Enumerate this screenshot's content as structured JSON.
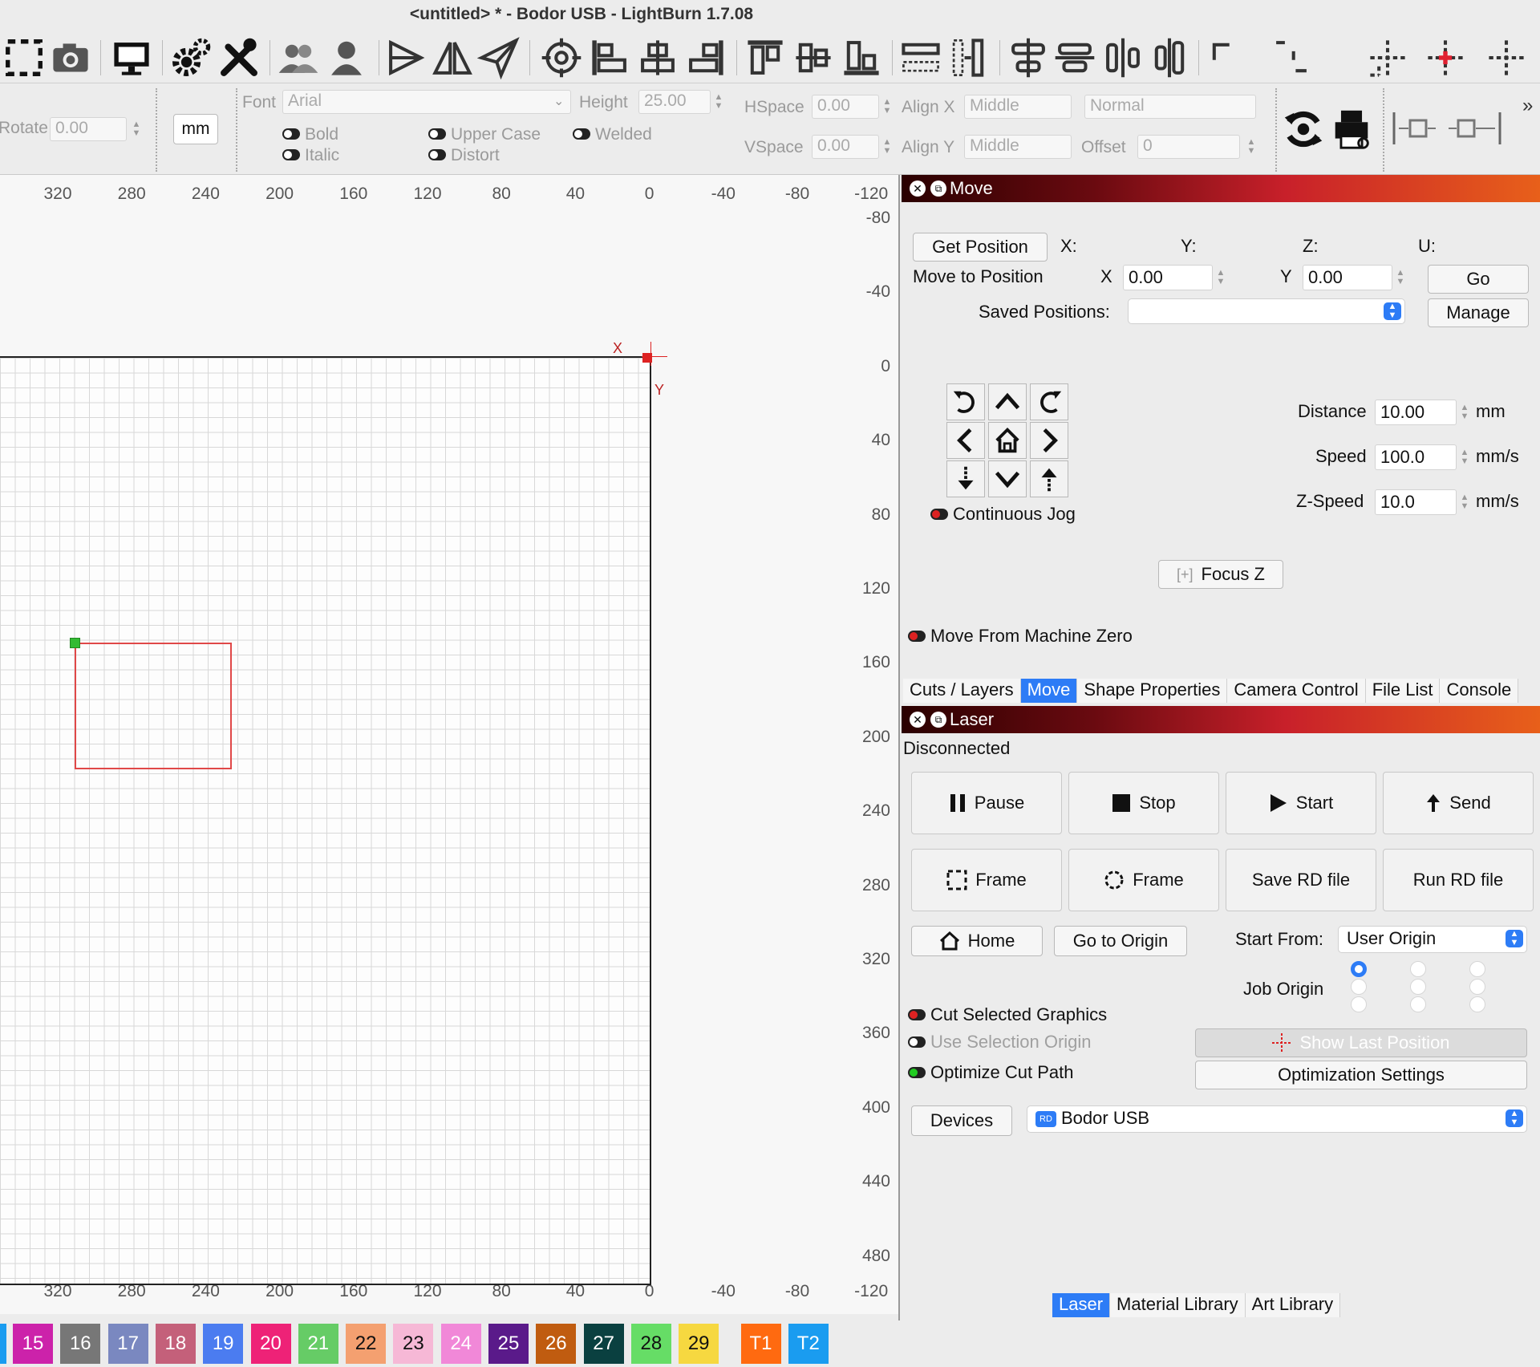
{
  "window": {
    "title": "<untitled> * - Bodor USB - LightBurn 1.7.08"
  },
  "toolbar": {
    "icons": [
      "select-icon",
      "camera-icon",
      "monitor-icon",
      "settings-icon",
      "tools-icon",
      "users-icon",
      "user-icon",
      "flip-horizontal-icon",
      "mirror-icon",
      "send-icon",
      "target-icon",
      "align-left-icon",
      "align-center-icon",
      "align-right-icon",
      "align-top-icon",
      "align-middle-icon",
      "align-bottom-icon",
      "distribute-h-icon",
      "distribute-v-icon",
      "space-h-icon",
      "space-v-icon",
      "center-h-icon",
      "center-v-icon",
      "corner-tl-icon",
      "corner-br-icon",
      "crosshair-left-icon",
      "crosshair-red-icon",
      "crosshair-right-icon"
    ]
  },
  "options": {
    "rotate_label": "Rotate",
    "rotate_value": "0.00",
    "unit": "mm",
    "font_label": "Font",
    "font_value": "Arial",
    "height_label": "Height",
    "height_value": "25.00",
    "bold": "Bold",
    "italic": "Italic",
    "upper_case": "Upper Case",
    "distort": "Distort",
    "welded": "Welded",
    "hspace_label": "HSpace",
    "hspace_value": "0.00",
    "vspace_label": "VSpace",
    "vspace_value": "0.00",
    "alignx_label": "Align X",
    "alignx_value": "Middle",
    "aligny_label": "Align Y",
    "aligny_value": "Middle",
    "mode_value": "Normal",
    "offset_label": "Offset",
    "offset_value": "0",
    "more": "»"
  },
  "canvas": {
    "x_ticks": [
      "320",
      "280",
      "240",
      "200",
      "160",
      "120",
      "80",
      "40",
      "0",
      "-40",
      "-80",
      "-120"
    ],
    "y_ticks": [
      "-80",
      "-40",
      "0",
      "40",
      "80",
      "120",
      "160",
      "200",
      "240",
      "280",
      "320",
      "360",
      "400",
      "440",
      "480"
    ],
    "x_axis_label": "X",
    "y_axis_label": "Y"
  },
  "move_panel": {
    "title": "Move",
    "get_position": "Get Position",
    "x_col": "X:",
    "y_col": "Y:",
    "z_col": "Z:",
    "u_col": "U:",
    "move_to_position": "Move to Position",
    "x_label": "X",
    "x_value": "0.00",
    "y_label": "Y",
    "y_value": "0.00",
    "go": "Go",
    "saved_positions": "Saved Positions:",
    "manage": "Manage",
    "distance_label": "Distance",
    "distance_value": "10.00",
    "distance_unit": "mm",
    "speed_label": "Speed",
    "speed_value": "100.0",
    "speed_unit": "mm/s",
    "zspeed_label": "Z-Speed",
    "zspeed_value": "10.0",
    "zspeed_unit": "mm/s",
    "continuous_jog": "Continuous Jog",
    "focus_z": "Focus Z",
    "move_from_machine_zero": "Move From Machine Zero",
    "tabs": [
      "Cuts / Layers",
      "Move",
      "Shape Properties",
      "Camera Control",
      "File List",
      "Console"
    ]
  },
  "laser_panel": {
    "title": "Laser",
    "status": "Disconnected",
    "pause": "Pause",
    "stop": "Stop",
    "start": "Start",
    "send": "Send",
    "frame1": "Frame",
    "frame2": "Frame",
    "save_rd": "Save RD file",
    "run_rd": "Run RD file",
    "home": "Home",
    "go_to_origin": "Go to Origin",
    "start_from_label": "Start From:",
    "start_from_value": "User Origin",
    "job_origin": "Job Origin",
    "cut_selected": "Cut Selected Graphics",
    "use_selection_origin": "Use Selection Origin",
    "optimize_cut_path": "Optimize Cut Path",
    "show_last_position": "Show Last Position",
    "optimization_settings": "Optimization Settings",
    "devices": "Devices",
    "device_value": "Bodor USB",
    "bottom_tabs": [
      "Laser",
      "Material Library",
      "Art Library"
    ]
  },
  "palette": {
    "swatches": [
      {
        "label": "15",
        "color": "#cc22aa"
      },
      {
        "label": "16",
        "color": "#777777"
      },
      {
        "label": "17",
        "color": "#7a88c0"
      },
      {
        "label": "18",
        "color": "#c4607a"
      },
      {
        "label": "19",
        "color": "#4b7cf0"
      },
      {
        "label": "20",
        "color": "#ee2277"
      },
      {
        "label": "21",
        "color": "#66cc66"
      },
      {
        "label": "22",
        "color": "#f4a070"
      },
      {
        "label": "23",
        "color": "#f6b8d6"
      },
      {
        "label": "24",
        "color": "#f188d8"
      },
      {
        "label": "25",
        "color": "#5a1a8a"
      },
      {
        "label": "26",
        "color": "#c05c10"
      },
      {
        "label": "27",
        "color": "#0a4040"
      },
      {
        "label": "28",
        "color": "#66dd66"
      },
      {
        "label": "29",
        "color": "#f6d840"
      },
      {
        "label": "T1",
        "color": "#ff6a10"
      },
      {
        "label": "T2",
        "color": "#1a9cf0"
      }
    ],
    "edge_color": "#1a9cf0"
  }
}
